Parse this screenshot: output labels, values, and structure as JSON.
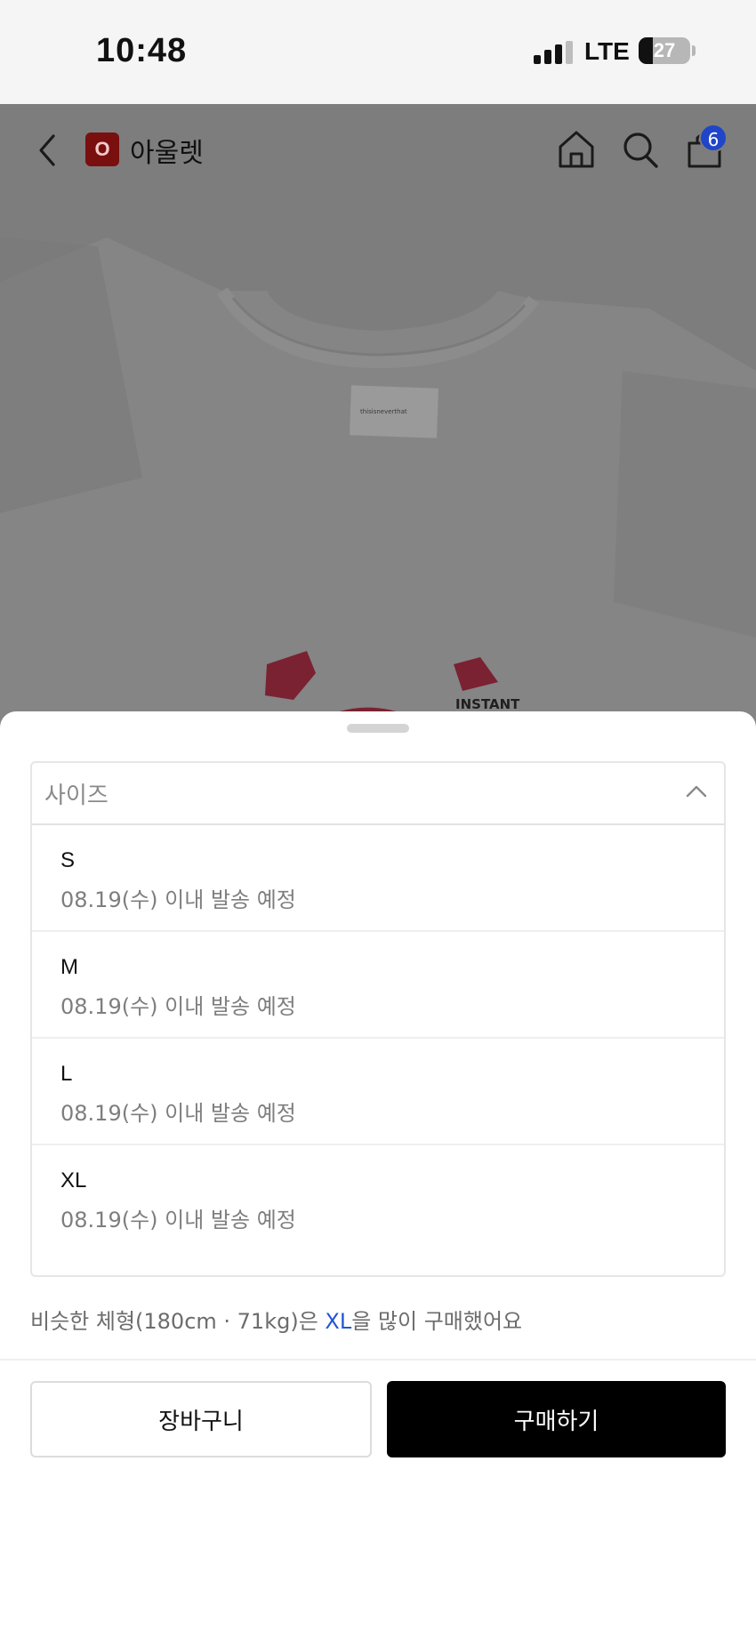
{
  "status_bar": {
    "time": "10:48",
    "network": "LTE",
    "battery": "27",
    "battery_level_percent": 27
  },
  "header": {
    "brand_logo_letter": "O",
    "brand_name": "아울렛",
    "cart_badge_count": "6",
    "icons": [
      "back-icon",
      "home-icon",
      "search-icon",
      "shopping-bag-icon"
    ]
  },
  "product_image": {
    "label_text": "thisisneverthat",
    "print_text": "INSTANT"
  },
  "sheet": {
    "select": {
      "placeholder": "사이즈",
      "icon": "chevron-up-icon",
      "options": [
        {
          "size": "S",
          "shipping": "08.19(수) 이내 발송 예정"
        },
        {
          "size": "M",
          "shipping": "08.19(수) 이내 발송 예정"
        },
        {
          "size": "L",
          "shipping": "08.19(수) 이내 발송 예정"
        },
        {
          "size": "XL",
          "shipping": "08.19(수) 이내 발송 예정"
        }
      ]
    },
    "recommendation": {
      "prefix": "비슷한 체형(180cm · 71kg)은 ",
      "highlight": "XL",
      "suffix": "을 많이 구매했어요"
    },
    "buttons": {
      "cart_label": "장바구니",
      "buy_label": "구매하기"
    }
  },
  "colors": {
    "overlay_bg": "#7d7d7d",
    "highlight_blue": "#2255d6",
    "badge_blue": "#2045c8",
    "buy_button": "#000000",
    "brand_red": "#7a0f0f"
  }
}
